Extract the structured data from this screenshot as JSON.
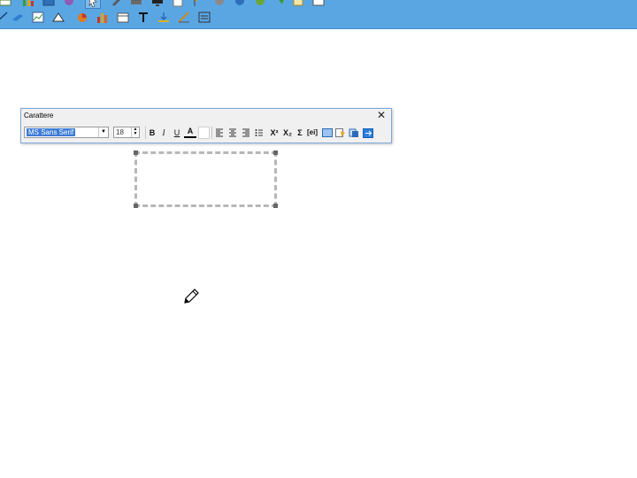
{
  "dialog": {
    "title": "Carattere",
    "close_glyph": "✕",
    "font_name": "MS Sans Serif",
    "font_size": "18",
    "select_arrow": "▼",
    "spin_up": "▲",
    "spin_down": "▼",
    "buttons": {
      "bold": "B",
      "italic": "I",
      "underline": "U",
      "font_color": "A",
      "superscript": "X²",
      "subscript": "X₂",
      "sum": "Σ",
      "field": "[ei]"
    }
  },
  "toolbar_icons": {
    "row1": [
      "table-icon",
      "chart-icon",
      "image-icon",
      "shape-icon",
      "select-arrow-icon",
      "pen-icon",
      "print-icon",
      "monitor-icon",
      "page-icon",
      "flag-icon",
      "globe-icon",
      "ball-icon",
      "link-icon",
      "note-icon",
      "window-icon"
    ],
    "row2": [
      "line-icon",
      "rectangle-icon",
      "graph-icon",
      "triangle-icon",
      "pie-icon",
      "bar-chart-icon",
      "calendar-icon",
      "text-tool-icon",
      "download-icon",
      "ruler-icon",
      "stamp-icon"
    ]
  },
  "colors": {
    "toolbar": "#5aa6e3",
    "selection": "#3c7bd6",
    "dialog_border": "#7fa7d9",
    "box_border": "#b7b7b7"
  }
}
